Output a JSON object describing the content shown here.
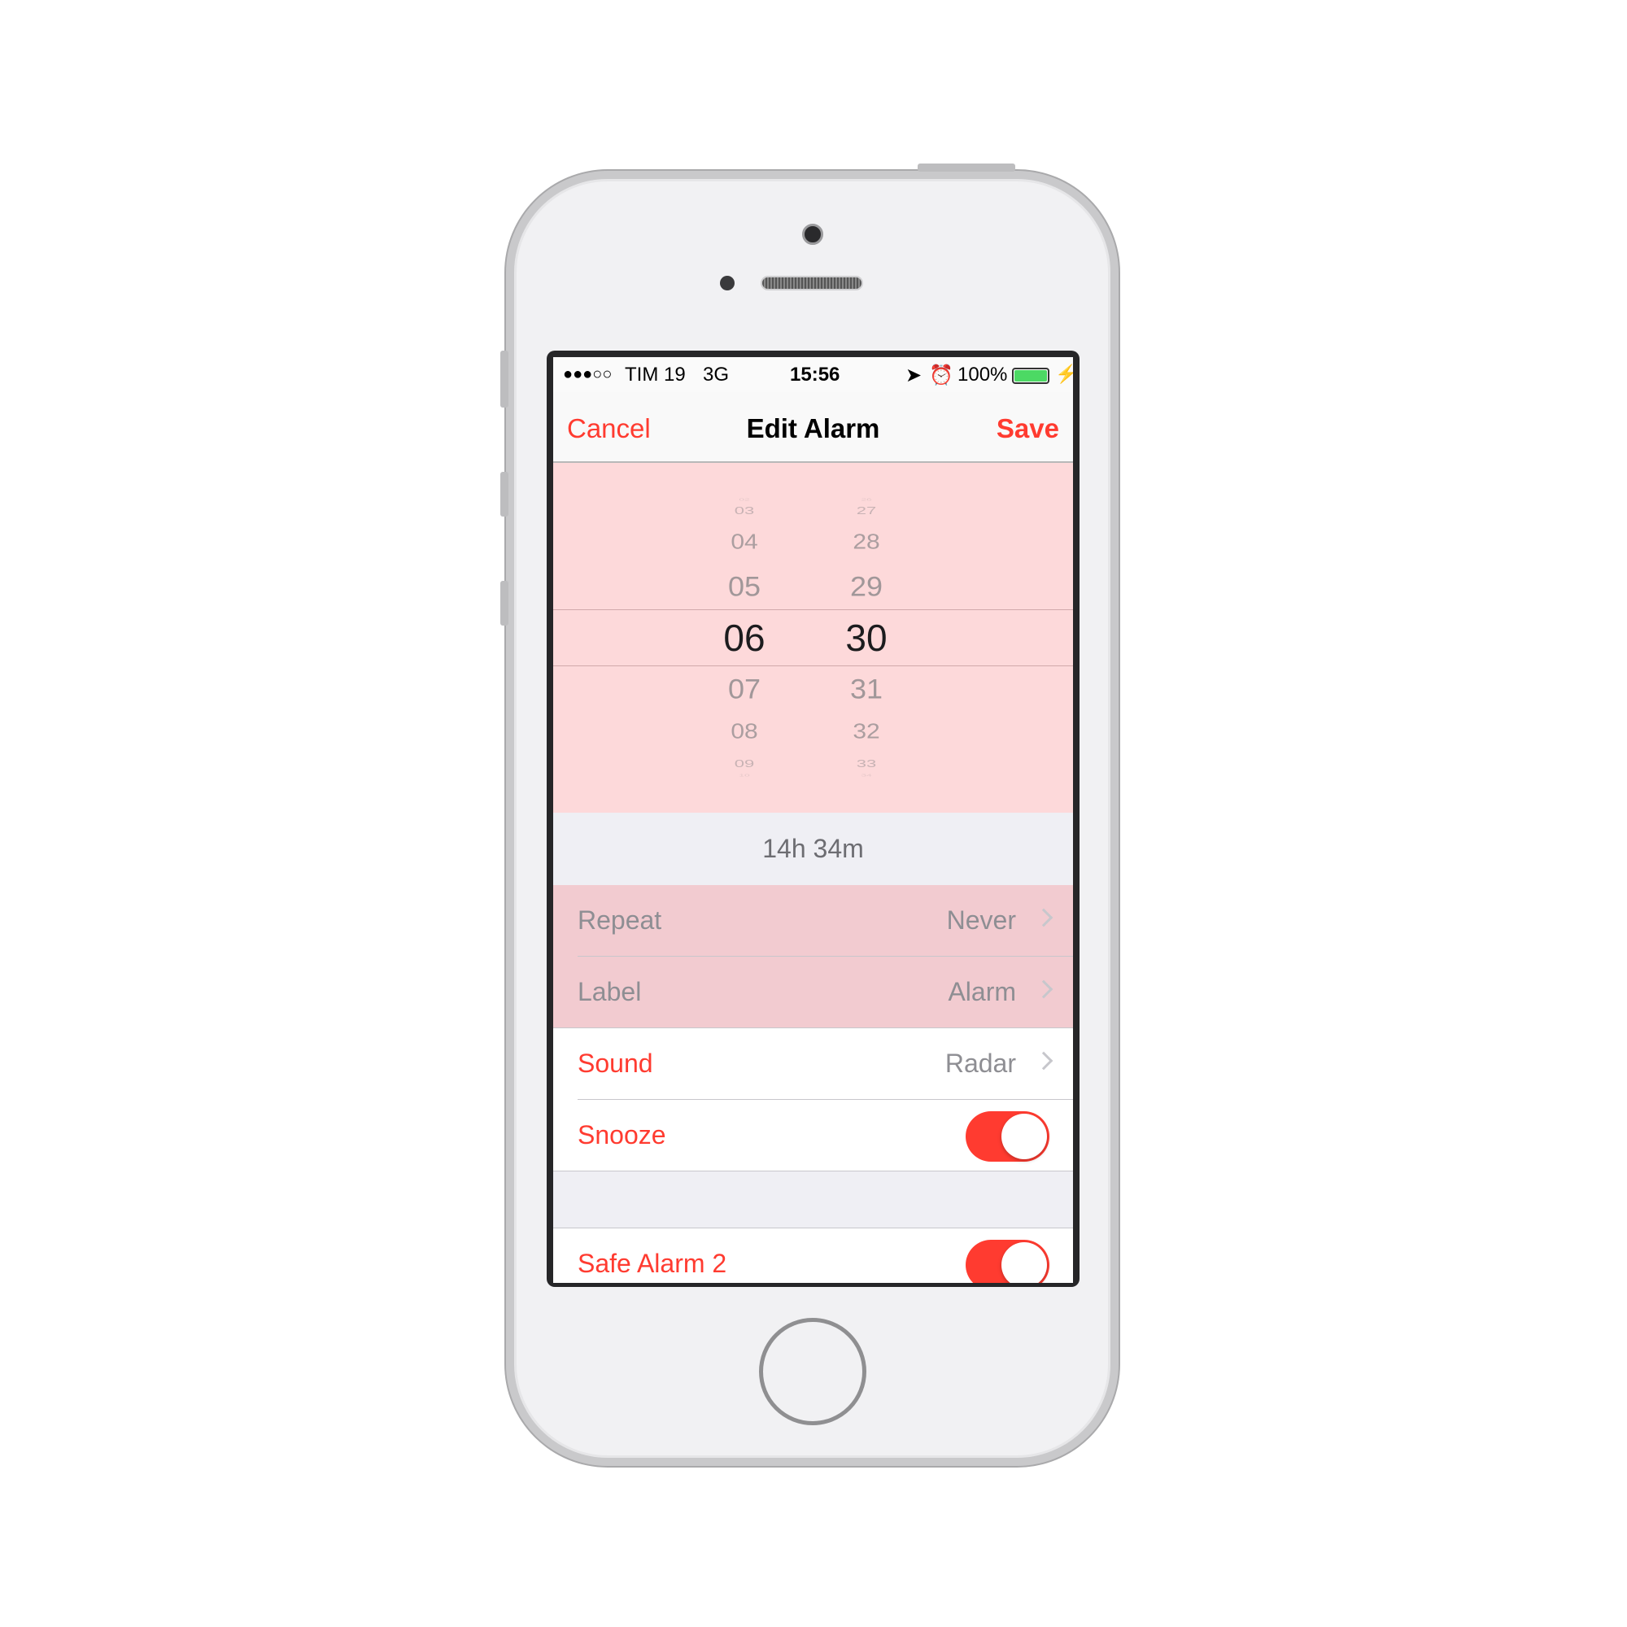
{
  "status_bar": {
    "signal": "●●●○○",
    "carrier": "TIM 19",
    "network": "3G",
    "time": "15:56",
    "battery": "100%",
    "icons": [
      "location-arrow-icon",
      "alarm-clock-icon",
      "battery-icon",
      "charging-bolt-icon"
    ],
    "battery_level": 1.0
  },
  "nav": {
    "cancel": "Cancel",
    "title": "Edit Alarm",
    "save": "Save"
  },
  "picker": {
    "hours": [
      "02",
      "03",
      "04",
      "05",
      "06",
      "07",
      "08",
      "09",
      "10"
    ],
    "minutes": [
      "26",
      "27",
      "28",
      "29",
      "30",
      "31",
      "32",
      "33",
      "34"
    ],
    "selected_hour": "06",
    "selected_minute": "30"
  },
  "duration": "14h 34m",
  "rows": [
    {
      "label": "Repeat",
      "value": "Never"
    },
    {
      "label": "Label",
      "value": "Alarm"
    },
    {
      "label": "Sound",
      "value": "Radar"
    },
    {
      "label": "Snooze",
      "toggle": true
    },
    {
      "label": "Safe Alarm 2",
      "toggle": true
    }
  ],
  "colors": {
    "accent": "#ff3b30",
    "highlight": "#fdd9da",
    "row_highlight": "#f2cbd0",
    "battery": "#4cd964"
  }
}
